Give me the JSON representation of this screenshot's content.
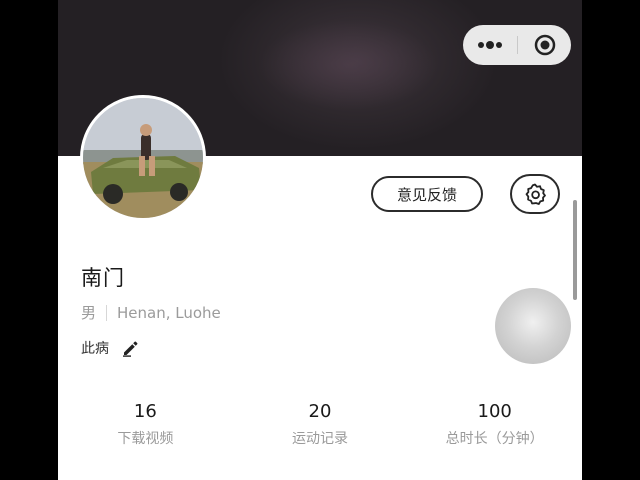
{
  "capsule": {
    "menu_icon": "more-dots-icon",
    "close_icon": "target-close-icon"
  },
  "profile": {
    "name": "南门",
    "gender": "男",
    "location": "Henan, Luohe",
    "bio": "此病",
    "avatar_icon": "avatar-photo"
  },
  "actions": {
    "feedback_label": "意见反馈",
    "settings_icon": "gear-icon",
    "edit_icon": "pencil-icon"
  },
  "stats": [
    {
      "value": "16",
      "label": "下载视频"
    },
    {
      "value": "20",
      "label": "运动记录"
    },
    {
      "value": "100",
      "label": "总时长（分钟）"
    }
  ],
  "colors": {
    "header_bg": "#2e282d",
    "capsule_bg": "#e9e9e9",
    "text_primary": "#1a1a1a",
    "text_secondary": "#9b9b9b"
  }
}
